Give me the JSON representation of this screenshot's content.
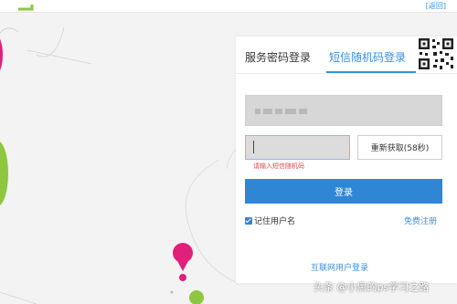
{
  "topbar": {
    "back_link": "[返回]"
  },
  "login": {
    "tabs": [
      {
        "label": "服务密码登录",
        "active": false
      },
      {
        "label": "短信随机码登录",
        "active": true
      }
    ],
    "resend_button": "重新获取(58秒)",
    "code_error": "请输入短信随机码",
    "login_button": "登录",
    "remember_label": "记住用户名",
    "remember_checked": true,
    "register_link": "免费注册",
    "internet_login_link": "互联网用户登录"
  },
  "watermark": "头条 @小黑的ps学习之路",
  "colors": {
    "accent": "#2f86d4",
    "link": "#3a8fd8",
    "error": "#e04a4a",
    "background": "#f3f3f3"
  }
}
